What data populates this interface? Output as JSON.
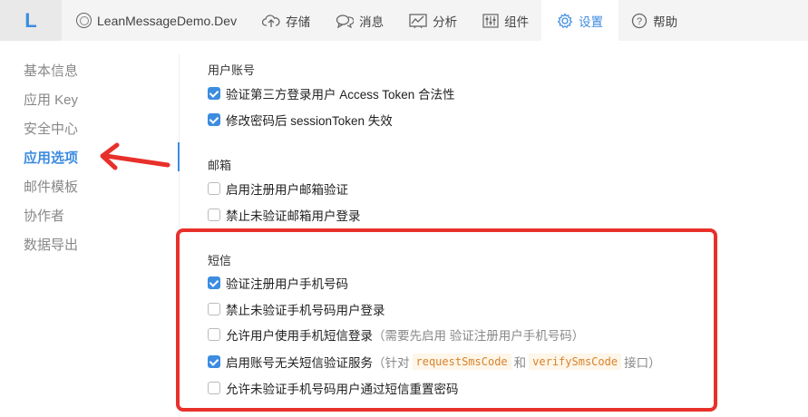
{
  "topbar": {
    "logo": "L",
    "app_name": "LeanMessageDemo.Dev",
    "nav": [
      {
        "label": "存储",
        "icon": "cloud-upload-icon"
      },
      {
        "label": "消息",
        "icon": "chat-bubbles-icon"
      },
      {
        "label": "分析",
        "icon": "chart-icon"
      },
      {
        "label": "组件",
        "icon": "sliders-icon"
      },
      {
        "label": "设置",
        "icon": "gear-icon",
        "active": true
      },
      {
        "label": "帮助",
        "icon": "help-icon"
      }
    ]
  },
  "sidebar": {
    "items": [
      {
        "label": "基本信息"
      },
      {
        "label": "应用 Key"
      },
      {
        "label": "安全中心"
      },
      {
        "label": "应用选项",
        "active": true
      },
      {
        "label": "邮件模板"
      },
      {
        "label": "协作者"
      },
      {
        "label": "数据导出"
      }
    ]
  },
  "sections": {
    "user_account": {
      "title": "用户账号",
      "options": [
        {
          "label": "验证第三方登录用户 Access Token 合法性",
          "checked": true
        },
        {
          "label": "修改密码后 sessionToken 失效",
          "checked": true
        }
      ]
    },
    "email": {
      "title": "邮箱",
      "options": [
        {
          "label": "启用注册用户邮箱验证",
          "checked": false
        },
        {
          "label": "禁止未验证邮箱用户登录",
          "checked": false
        }
      ]
    },
    "sms": {
      "title": "短信",
      "options": [
        {
          "label": "验证注册用户手机号码",
          "checked": true
        },
        {
          "label": "禁止未验证手机号码用户登录",
          "checked": false
        },
        {
          "label": "允许用户使用手机短信登录",
          "hint": "（需要先启用 验证注册用户手机号码）",
          "checked": false
        },
        {
          "label": "启用账号无关短信验证服务",
          "hint_pre": "（针对",
          "code1": "requestSmsCode",
          "hint_mid": "和",
          "code2": "verifySmsCode",
          "hint_post": "接口）",
          "checked": true
        },
        {
          "label": "允许未验证手机号码用户通过短信重置密码",
          "checked": false
        }
      ]
    }
  },
  "colors": {
    "accent": "#3c8ce0",
    "annotation": "#e8302b"
  }
}
